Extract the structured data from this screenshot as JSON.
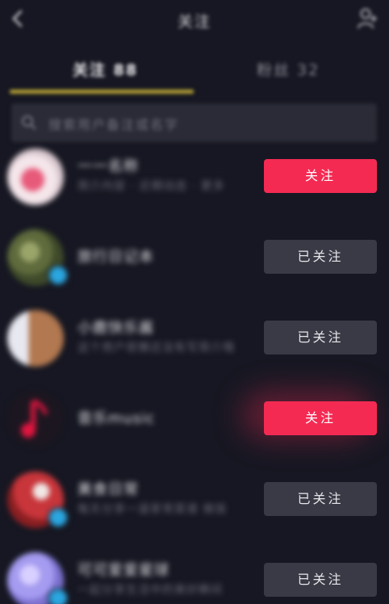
{
  "header": {
    "title": "关注",
    "back_icon": "chevron-left-icon",
    "add_icon": "add-user-icon"
  },
  "tabs": [
    {
      "label": "关注 88",
      "active": true
    },
    {
      "label": "粉丝 32",
      "active": false
    }
  ],
  "search": {
    "placeholder": "搜索用户备注或名字"
  },
  "list": [
    {
      "username": "一一名称",
      "subtitle": "简介内容 · 近期动态 · 更多",
      "button": "关注",
      "state": "follow",
      "verified": false,
      "avatar_color": "#f1e3e6"
    },
    {
      "username": "旅行日记本",
      "subtitle": "",
      "button": "已关注",
      "state": "followed",
      "verified": true,
      "avatar_color": "#6f7c4a"
    },
    {
      "username": "小鹿快乐酱",
      "subtitle": "这个用户很懒还没有写简介哦",
      "button": "已关注",
      "state": "followed",
      "verified": false,
      "avatar_color": "#c9a58b"
    },
    {
      "username": "音乐music",
      "subtitle": "",
      "button": "关注",
      "state": "follow",
      "verified": false,
      "avatar_color": "#d4153e"
    },
    {
      "username": "美食日常",
      "subtitle": "每天分享一道家常菜谱 做饭",
      "button": "已关注",
      "state": "followed",
      "verified": true,
      "avatar_color": "#c8353a"
    },
    {
      "username": "可可爱爱星球",
      "subtitle": "一起分享生活中的美好瞬间",
      "button": "已关注",
      "state": "followed",
      "verified": true,
      "avatar_color": "#a59bf0"
    }
  ],
  "colors": {
    "background": "#161722",
    "accent": "#f42a53",
    "followed_button": "#393a45",
    "tab_indicator": "#b9a437"
  }
}
